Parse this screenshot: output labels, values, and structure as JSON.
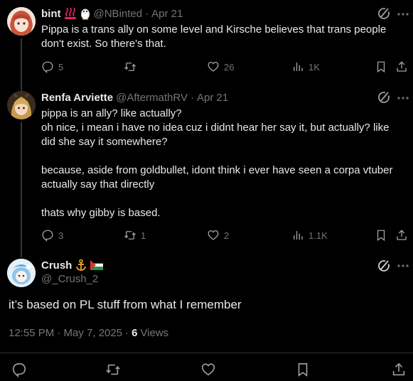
{
  "tweets": [
    {
      "name": "bint",
      "handle": "@NBinted",
      "time": "Apr 21",
      "text": "Pippa is a trans ally on some level and Kirsche believes that trans people don't exist. So there's that.",
      "replies": "5",
      "reposts": "",
      "likes": "26",
      "views": "1K",
      "emojis": [
        "hot-springs-emoji",
        "penguin-emoji"
      ]
    },
    {
      "name": "Renfa Arviette",
      "handle": "@AftermathRV",
      "time": "Apr 21",
      "text": "pippa is an ally? like actually?\noh nice, i mean i have no idea cuz i didnt hear her say it, but actually? like did she say it somewhere?\n\nbecause, aside from goldbullet, idont think i ever have seen a corpa vtuber actually say that directly\n\nthats why gibby is based.",
      "replies": "3",
      "reposts": "1",
      "likes": "2",
      "views": "1.1K"
    }
  ],
  "main": {
    "name": "Crush",
    "handle": "@_Crush_2",
    "text": "it’s based on PL stuff from what I remember",
    "timestamp": "12:55 PM · May 7, 2025",
    "separator": "·",
    "views_count": "6",
    "views_label": "Views",
    "emojis": [
      "anchor-emoji",
      "palestine-flag-emoji"
    ]
  },
  "separator": "·",
  "colors": {
    "background": "#000000",
    "text": "#e7e9ea",
    "muted": "#71767b",
    "divider": "#2f3336"
  }
}
